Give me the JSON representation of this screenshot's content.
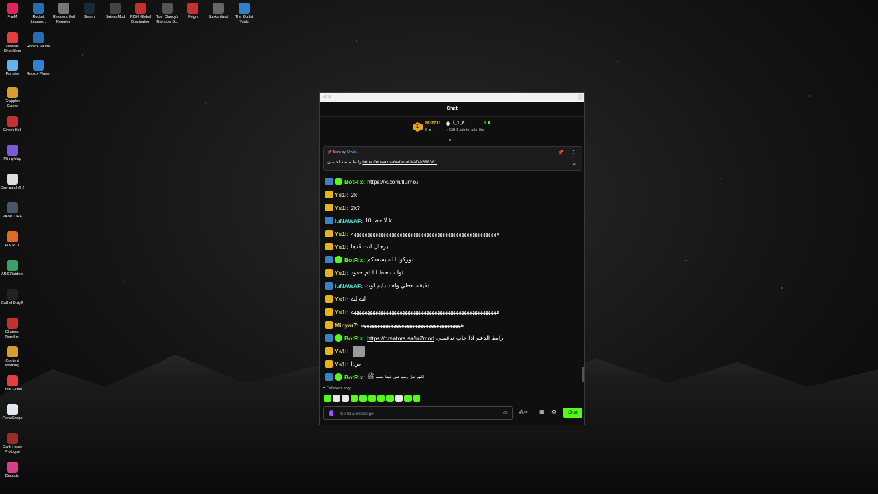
{
  "desktop": {
    "icons": [
      {
        "label": "FiveM",
        "color": "#e0245e"
      },
      {
        "label": "Rocket League...",
        "color": "#2b6cb0"
      },
      {
        "label": "Resident Evil Requiem",
        "color": "#777777"
      },
      {
        "label": "Steam",
        "color": "#1b2838"
      },
      {
        "label": "BakkesMod",
        "color": "#444444"
      },
      {
        "label": "RISK Global Domination",
        "color": "#c53030"
      },
      {
        "label": "Tom Clancy's Rainbow S...",
        "color": "#555555"
      },
      {
        "label": "Feign",
        "color": "#c53030"
      },
      {
        "label": "Sunkenland",
        "color": "#666666"
      },
      {
        "label": "The Outlist Trials",
        "color": "#3182ce"
      },
      {
        "label": "Double Shoulders",
        "color": "#e53e3e"
      },
      {
        "label": "Roblox Studio",
        "color": "#2b6cb0"
      },
      {
        "label": "Fortnite",
        "color": "#63b3ed"
      },
      {
        "label": "Roblox Player",
        "color": "#3182ce"
      },
      {
        "label": "Grapples Galore",
        "color": "#d69e2e"
      },
      {
        "label": "Green Hell",
        "color": "#c53030"
      },
      {
        "label": "MinnyMap",
        "color": "#805ad5"
      },
      {
        "label": "Overwatch® 2",
        "color": "#dddddd"
      },
      {
        "label": "PANICORE",
        "color": "#4a5568"
      },
      {
        "label": "R.E.P.O.",
        "color": "#dd6b20"
      },
      {
        "label": "ARC Raiders",
        "color": "#38a169"
      },
      {
        "label": "Call of Duty®",
        "color": "#222222"
      },
      {
        "label": "Chained Together",
        "color": "#c53030"
      },
      {
        "label": "Content Warning",
        "color": "#d69e2e"
      },
      {
        "label": "Crab Game",
        "color": "#e53e3e"
      },
      {
        "label": "CurseForge",
        "color": "#e2e8f0"
      },
      {
        "label": "Dark Hours Prologue",
        "color": "#9b2c2c"
      },
      {
        "label": "Deducto",
        "color": "#d53f8c"
      }
    ]
  },
  "window": {
    "tab_title": "chat",
    "header_title": "Chat",
    "leaderboard": {
      "rank": "1",
      "first_name": "M3tz11",
      "first_count": "5",
      "second_name": "i_1_a",
      "second_count": "1",
      "gift_text": "Gift 1 sub to take 3rd"
    },
    "pinned": {
      "sent_by_label": "Sent by",
      "sent_by_user": "Klwtn1",
      "text_prefix": "رابط منصة احسان",
      "link": "https://ehsan.sa/referral/8ADA588381"
    },
    "messages": [
      {
        "user": "BotRix",
        "color": "#53fc18",
        "badges": [
          "mod",
          "verified"
        ],
        "text": "",
        "link": "https://x.com/llumo7"
      },
      {
        "user": "Ys1i",
        "color": "#e6d36a",
        "badges": [
          "crown"
        ],
        "text": "2k",
        "link": ""
      },
      {
        "user": "Ys1i",
        "color": "#e6d36a",
        "badges": [
          "crown"
        ],
        "text": "2k?",
        "link": ""
      },
      {
        "user": "luNAWAF",
        "color": "#4fd1c5",
        "badges": [
          "mod"
        ],
        "text": "لا حظ 10 k",
        "link": ""
      },
      {
        "user": "Ys1i",
        "color": "#e6d36a",
        "badges": [
          "crown"
        ],
        "text": "ههههههههههههههههههههههههههههههههههههههههههههههههههههههه",
        "link": ""
      },
      {
        "user": "Ys1i",
        "color": "#e6d36a",
        "badges": [
          "crown"
        ],
        "text": "يرجال انت قدها",
        "link": ""
      },
      {
        "user": "BotRix",
        "color": "#53fc18",
        "badges": [
          "mod",
          "verified"
        ],
        "text": "نوركوا الله يسعدكم",
        "link": ""
      },
      {
        "user": "Ys1i",
        "color": "#e6d36a",
        "badges": [
          "crown"
        ],
        "text": "ثوانب حظ انا ذم حدود",
        "link": ""
      },
      {
        "user": "luNAWAF",
        "color": "#4fd1c5",
        "badges": [
          "mod"
        ],
        "text": "دقيقه بعطي واحد دايم اوت",
        "link": ""
      },
      {
        "user": "Ys1i",
        "color": "#e6d36a",
        "badges": [
          "crown"
        ],
        "text": "ليه ليه",
        "link": ""
      },
      {
        "user": "Ys1i",
        "color": "#e6d36a",
        "badges": [
          "crown"
        ],
        "text": "ههههههههههههههههههههههههههههههههههههههههههههههههههههههه",
        "link": ""
      },
      {
        "user": "Minyar7",
        "color": "#e6d36a",
        "badges": [
          "crown"
        ],
        "text": "هههههههههههههههههههههههههههههههههههههه",
        "link": ""
      },
      {
        "user": "BotRix",
        "color": "#53fc18",
        "badges": [
          "mod",
          "verified"
        ],
        "text": "رابط الدعم اذا حاب تدعمني",
        "link": "https://creators.sa/lu7mod"
      },
      {
        "user": "Ys1i",
        "color": "#e6d36a",
        "badges": [
          "crown"
        ],
        "text": "",
        "link": "",
        "avatar": true
      },
      {
        "user": "Ys1i",
        "color": "#e6d36a",
        "badges": [
          "crown"
        ],
        "text": "ص:ا",
        "link": ""
      },
      {
        "user": "BotRix",
        "color": "#53fc18",
        "badges": [
          "mod",
          "verified"
        ],
        "text": "اللهم صل وسلم على نبينا محمد ﷺ",
        "link": ""
      }
    ],
    "followers_only": "Followers only",
    "input_placeholder": "Send a message",
    "chat_button": "Chat"
  }
}
